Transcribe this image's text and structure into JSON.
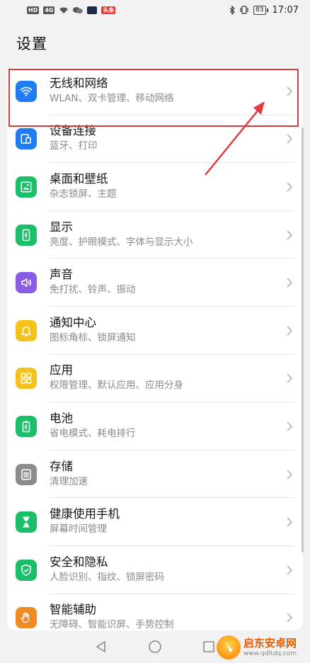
{
  "status_bar": {
    "hd_label": "HD",
    "signal_label": "4G",
    "app_badge": "头条",
    "battery": "83",
    "time": "17:07"
  },
  "page": {
    "title": "设置"
  },
  "settings": [
    {
      "title": "无线和网络",
      "subtitle": "WLAN、双卡管理、移动网络",
      "icon": "wifi-icon",
      "color": "#1f7cf2"
    },
    {
      "title": "设备连接",
      "subtitle": "蓝牙、打印",
      "icon": "device-connect-icon",
      "color": "#1f7cf2"
    },
    {
      "title": "桌面和壁纸",
      "subtitle": "杂志锁屏、主题",
      "icon": "wallpaper-icon",
      "color": "#1bbf6a"
    },
    {
      "title": "显示",
      "subtitle": "亮度、护眼模式、字体与显示大小",
      "icon": "display-icon",
      "color": "#1bbf6a"
    },
    {
      "title": "声音",
      "subtitle": "免打扰、铃声、振动",
      "icon": "sound-icon",
      "color": "#8a5ce6"
    },
    {
      "title": "通知中心",
      "subtitle": "图标角标、锁屏通知",
      "icon": "bell-icon",
      "color": "#f5c21b"
    },
    {
      "title": "应用",
      "subtitle": "权限管理、默认应用、应用分身",
      "icon": "apps-icon",
      "color": "#f5c21b"
    },
    {
      "title": "电池",
      "subtitle": "省电模式、耗电排行",
      "icon": "battery-icon",
      "color": "#1bbf6a"
    },
    {
      "title": "存储",
      "subtitle": "清理加速",
      "icon": "storage-icon",
      "color": "#8c8c8c"
    },
    {
      "title": "健康使用手机",
      "subtitle": "屏幕时间管理",
      "icon": "hourglass-icon",
      "color": "#1bbf6a"
    },
    {
      "title": "安全和隐私",
      "subtitle": "人脸识别、指纹、锁屏密码",
      "icon": "shield-icon",
      "color": "#1bbf6a"
    },
    {
      "title": "智能辅助",
      "subtitle": "无障碍、智能识屏、手势控制",
      "icon": "hand-icon",
      "color": "#f08a24"
    }
  ],
  "watermark": {
    "name": "启东安卓网",
    "url": "www.qdltdq.com"
  },
  "colors": {
    "highlight": "#d93a3a",
    "background": "#f2f2f2"
  }
}
